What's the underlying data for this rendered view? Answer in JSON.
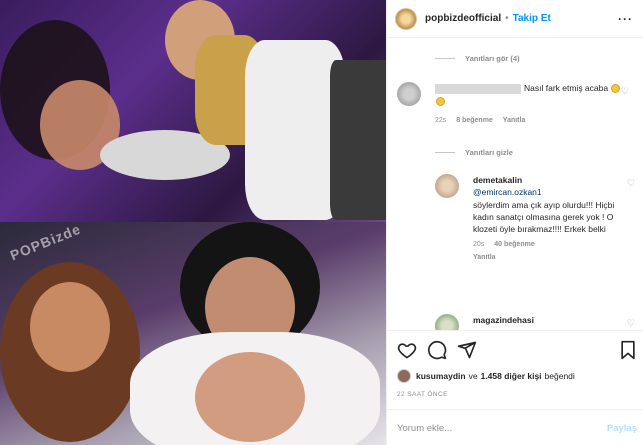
{
  "header": {
    "username": "popbizdeofficial",
    "separator": "•",
    "follow_label": "Takip Et",
    "more_label": "···"
  },
  "photo": {
    "watermark": "POPBizde"
  },
  "comments": {
    "view_replies": "Yanıtları gör (4)",
    "hide_replies": "Yanıtları gizle",
    "items": [
      {
        "username": "",
        "text": "Nasıl fark etmiş acaba",
        "emoji_count": 2,
        "time": "22s",
        "likes": "8 beğenme",
        "reply": "Yanıtla"
      },
      {
        "username": "demetakalin",
        "mention": "@emircan.ozkan1",
        "text": "söylerdim ama çık ayıp olurdu!!! Hiçbi kadın sanatçı olmasına gerek yok ! O klozeti öyle bırakmaz!!!! Erkek belki",
        "time": "20s",
        "likes": "40 beğenme",
        "reply": "Yanıtla"
      },
      {
        "username": "magazindehasi",
        "text": ""
      }
    ]
  },
  "likes": {
    "user": "kusumaydin",
    "connector": "ve",
    "others": "1.458 diğer kişi",
    "suffix": "beğendi"
  },
  "time_ago": "22 SAAT ÖNCE",
  "input": {
    "placeholder": "Yorum ekle...",
    "post_label": "Paylaş"
  },
  "colors": {
    "accent": "#0095f6",
    "muted": "#8e8e8e"
  }
}
